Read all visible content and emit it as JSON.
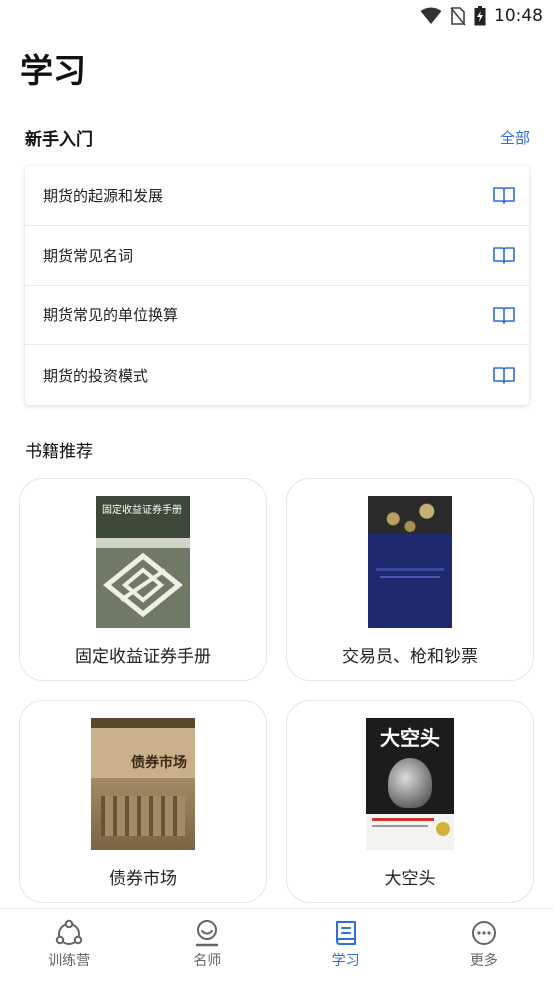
{
  "status": {
    "time": "10:48",
    "icons": [
      "wifi-icon",
      "no-sim-icon",
      "battery-charging-icon"
    ]
  },
  "page": {
    "title": "学习"
  },
  "beginner": {
    "title": "新手入门",
    "more": "全部",
    "items": [
      {
        "label": "期货的起源和发展",
        "icon": "book-open-icon"
      },
      {
        "label": "期货常见名词",
        "icon": "book-open-icon"
      },
      {
        "label": "期货常见的单位换算",
        "icon": "book-open-icon"
      },
      {
        "label": "期货的投资模式",
        "icon": "book-open-icon"
      }
    ]
  },
  "books": {
    "title": "书籍推荐",
    "items": [
      {
        "name": "固定收益证券手册",
        "cover_title": "固定收益证券手册"
      },
      {
        "name": "交易员、枪和钞票"
      },
      {
        "name": "债券市场",
        "cover_title": "债券市场"
      },
      {
        "name": "大空头",
        "cover_title": "大空头"
      }
    ]
  },
  "tabs": [
    {
      "label": "训练营",
      "icon": "camp-icon",
      "active": false
    },
    {
      "label": "名师",
      "icon": "teacher-icon",
      "active": false
    },
    {
      "label": "学习",
      "icon": "study-book-icon",
      "active": true
    },
    {
      "label": "更多",
      "icon": "more-icon",
      "active": false
    }
  ],
  "colors": {
    "accent": "#2f6fd8",
    "inactive": "#666666"
  }
}
